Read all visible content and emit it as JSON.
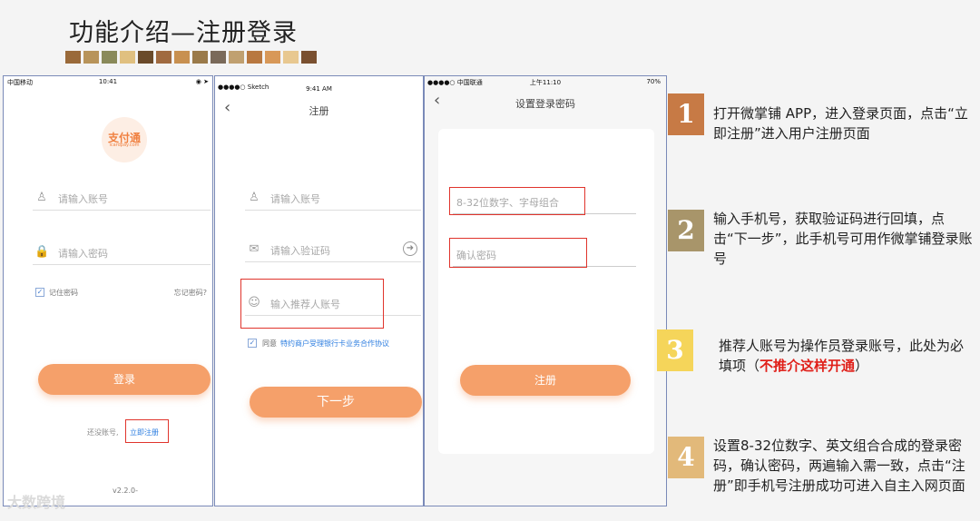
{
  "slide": {
    "title": "功能介绍—注册登录",
    "swatch_colors": [
      "#9a6a3a",
      "#b8945a",
      "#8a8a5a",
      "#e0c080",
      "#6a4a2a",
      "#a06a40",
      "#c89050",
      "#9a7a4a",
      "#7a6a5a",
      "#c0a070",
      "#b87840",
      "#d89858",
      "#e8c890",
      "#7a5030"
    ]
  },
  "phone1": {
    "status": {
      "carrier": "中国移动",
      "time": "10:41"
    },
    "logo": {
      "text": "支付通",
      "sub": "icardpay.com"
    },
    "account_placeholder": "请输入账号",
    "password_placeholder": "请输入密码",
    "remember_label": "记住密码",
    "forgot_label": "忘记密码?",
    "login_button": "登录",
    "no_account_label": "还没账号,",
    "register_link": "立即注册",
    "version": "v2.2.0-"
  },
  "phone2": {
    "status": {
      "carrier": "●●●●○ Sketch",
      "time": "9:41 AM"
    },
    "nav_title": "注册",
    "account_placeholder": "请输入账号",
    "code_placeholder": "请输入验证码",
    "referrer_placeholder": "输入推荐人账号",
    "agree_label": "同意",
    "agreement_link": "特约商户受理银行卡业务合作协议",
    "next_button": "下一步"
  },
  "phone3": {
    "status": {
      "carrier": "●●●●○ 中国联通",
      "time": "上午11:10",
      "battery": "70%"
    },
    "nav_title": "设置登录密码",
    "password_placeholder": "8-32位数字、字母组合",
    "confirm_placeholder": "确认密码",
    "register_button": "注册"
  },
  "steps": [
    {
      "num": "1",
      "color": "#c77a45",
      "text": "打开微掌铺 APP，进入登录页面，点击“立即注册”进入用户注册页面"
    },
    {
      "num": "2",
      "color": "#a8956a",
      "text": "输入手机号，获取验证码进行回填，点击“下一步”，此手机号可用作微掌铺登录账号"
    },
    {
      "num": "3",
      "color": "#f5d55a",
      "text_main": "推荐人账号为操作员登录账号，此处为必填项（",
      "text_warn": "不推介这样开通",
      "text_end": "）"
    },
    {
      "num": "4",
      "color": "#e2b97a",
      "text": "设置8-32位数字、英文组合合成的登录密码，确认密码，两遍输入需一致，点击“注册”即手机号注册成功可进入自主入网页面"
    }
  ],
  "watermark": "大数跨境"
}
